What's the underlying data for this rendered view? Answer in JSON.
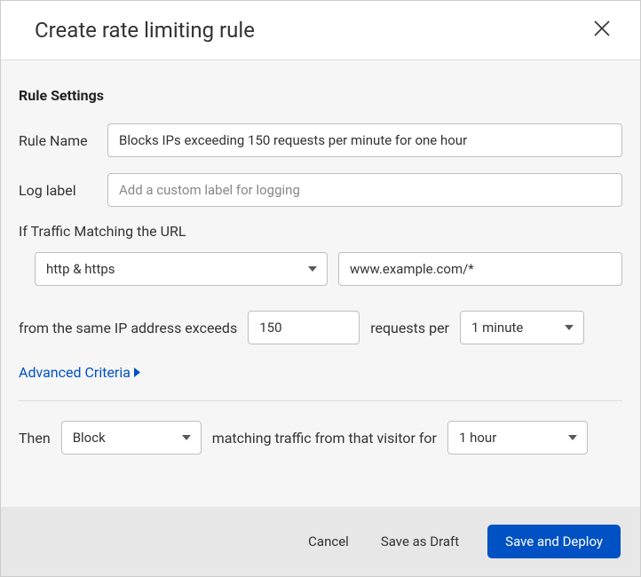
{
  "dialog": {
    "title": "Create rate limiting rule"
  },
  "settings": {
    "section_title": "Rule Settings",
    "rule_name_label": "Rule Name",
    "rule_name_value": "Blocks IPs exceeding 150 requests per minute for one hour",
    "log_label_label": "Log label",
    "log_label_placeholder": "Add a custom label for logging",
    "log_label_value": ""
  },
  "traffic": {
    "section_label": "If Traffic Matching the URL",
    "scheme_value": "http & https",
    "url_value": "www.example.com/*"
  },
  "condition": {
    "prefix": "from the same IP address exceeds",
    "count_value": "150",
    "mid": "requests per",
    "window_value": "1 minute"
  },
  "advanced": {
    "label": "Advanced Criteria"
  },
  "action": {
    "prefix": "Then",
    "type_value": "Block",
    "mid": "matching traffic from that visitor for",
    "duration_value": "1 hour"
  },
  "footer": {
    "cancel": "Cancel",
    "draft": "Save as Draft",
    "deploy": "Save and Deploy"
  }
}
